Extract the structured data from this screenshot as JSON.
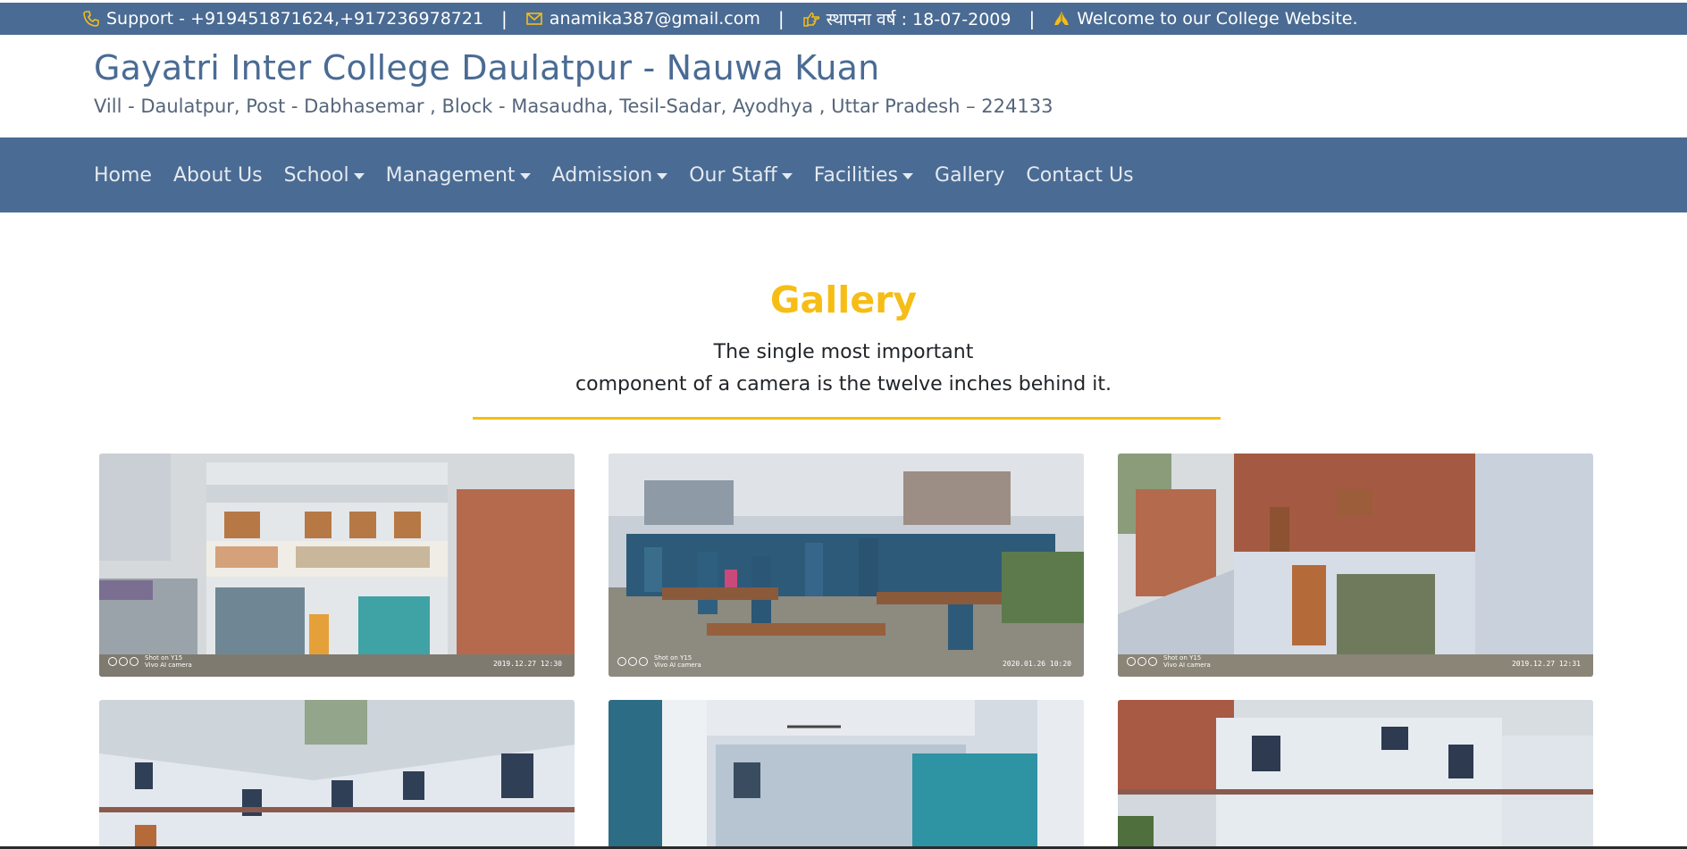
{
  "topbar": {
    "support": "Support - +919451871624,+917236978721",
    "email": "anamika387@gmail.com",
    "established": "स्थापना वर्ष : 18-07-2009",
    "welcome": "Welcome to our College Website.",
    "separator": "|",
    "icon_color": "#f6bd16"
  },
  "header": {
    "title": "Gayatri Inter College Daulatpur - Nauwa Kuan",
    "address": "Vill - Daulatpur, Post - Dabhasemar , Block - Masaudha, Tesil-Sadar, Ayodhya , Uttar Pradesh – 224133"
  },
  "nav": {
    "items": [
      {
        "label": "Home"
      },
      {
        "label": "About Us"
      },
      {
        "label": "School"
      },
      {
        "label": "Management"
      },
      {
        "label": "Admission"
      },
      {
        "label": "Our Staff"
      },
      {
        "label": "Facilities"
      },
      {
        "label": "Gallery"
      },
      {
        "label": "Contact Us"
      }
    ]
  },
  "gallery": {
    "title": "Gallery",
    "subtitle_line1": "The single most important",
    "subtitle_line2": "component of a camera is the twelve inches behind it.",
    "photos": [
      {
        "stamp": "2019.12.27 12:30",
        "camera_line1": "Shot on Y15",
        "camera_line2": "Vivo AI camera"
      },
      {
        "stamp": "2020.01.26 10:20",
        "camera_line1": "Shot on Y15",
        "camera_line2": "Vivo AI camera"
      },
      {
        "stamp": "2019.12.27 12:31",
        "camera_line1": "Shot on Y15",
        "camera_line2": "Vivo AI camera"
      }
    ]
  },
  "colors": {
    "brand": "#4a6b93",
    "accent": "#f6bd16"
  }
}
